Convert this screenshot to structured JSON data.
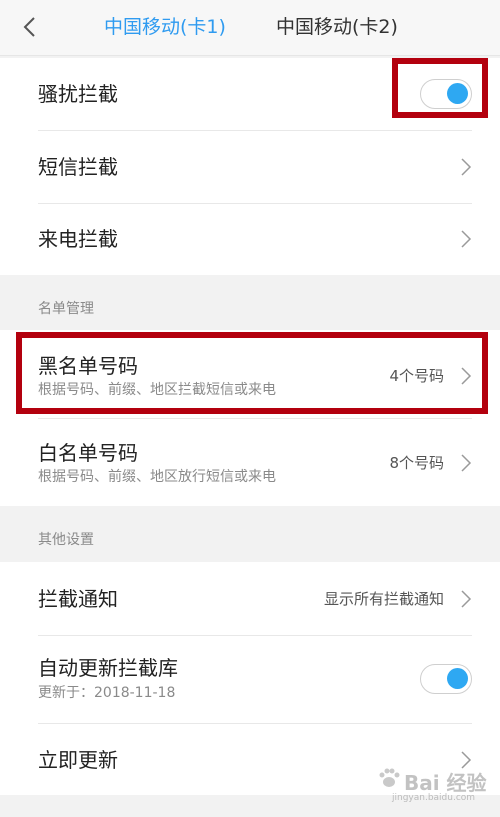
{
  "header": {
    "tabs": [
      {
        "label": "中国移动(卡1)",
        "active": true
      },
      {
        "label": "中国移动(卡2)",
        "active": false
      }
    ]
  },
  "intercept": {
    "harass_label": "骚扰拦截",
    "harass_on": true,
    "sms_label": "短信拦截",
    "call_label": "来电拦截"
  },
  "list_management": {
    "section_title": "名单管理",
    "blacklist": {
      "label": "黑名单号码",
      "sub": "根据号码、前缀、地区拦截短信或来电",
      "count": "4个号码"
    },
    "whitelist": {
      "label": "白名单号码",
      "sub": "根据号码、前缀、地区放行短信或来电",
      "count": "8个号码"
    }
  },
  "other_settings": {
    "section_title": "其他设置",
    "notify": {
      "label": "拦截通知",
      "value": "显示所有拦截通知"
    },
    "auto_update": {
      "label": "自动更新拦截库",
      "sub": "更新于：2018-11-18",
      "on": true
    },
    "update_now": {
      "label": "立即更新"
    }
  },
  "watermark": {
    "text": "Bai 经验",
    "url": "jingyan.baidu.com"
  },
  "colors": {
    "accent": "#2f9bf0",
    "toggle_on": "#2ea8f2",
    "highlight": "#b3000e"
  }
}
